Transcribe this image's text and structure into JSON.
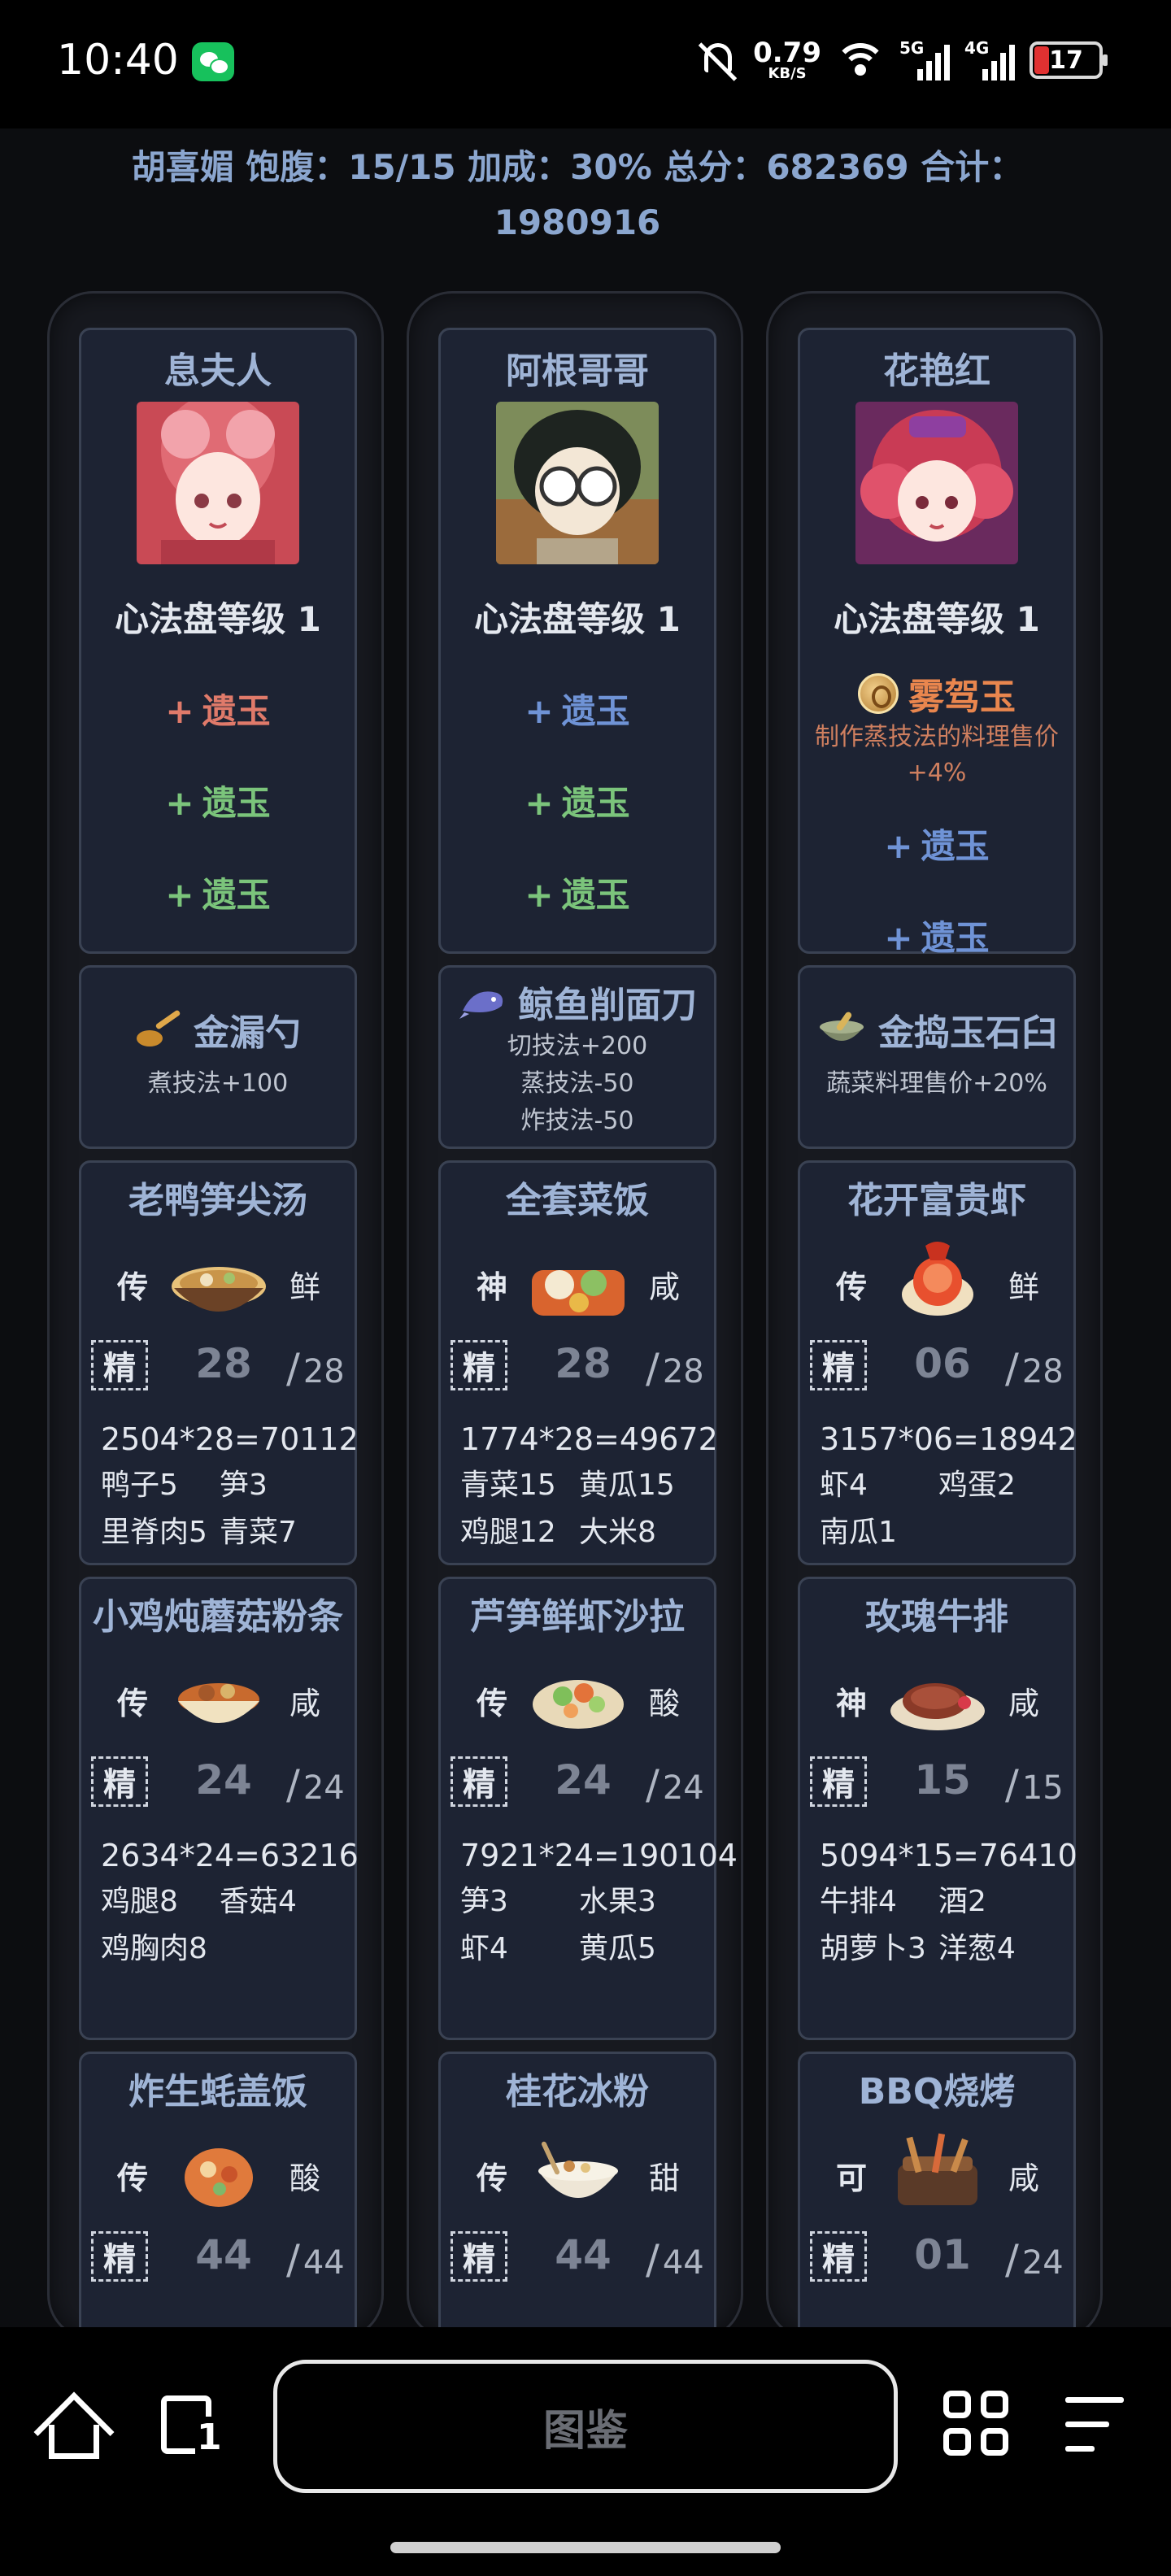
{
  "status_bar": {
    "time": "10:40",
    "net_speed": "0.79",
    "net_unit": "KB/S",
    "signal1": "5G",
    "signal2": "4G",
    "battery": "17",
    "icons": [
      "wechat-icon",
      "mute-icon",
      "wifi-icon",
      "signal-icon",
      "battery-icon"
    ]
  },
  "summary": {
    "line1": "胡喜媚 饱腹：15/15 加成：30% 总分：682369 合计：",
    "line2": "1980916"
  },
  "columns": [
    {
      "chef": {
        "name": "息夫人",
        "level": "心法盘等级 1",
        "relics": [
          {
            "plus": "+",
            "label": "遗玉",
            "color": "#e07a6a"
          },
          {
            "plus": "+",
            "label": "遗玉",
            "color": "#7bc47b"
          },
          {
            "plus": "+",
            "label": "遗玉",
            "color": "#7bc47b"
          }
        ]
      },
      "tool": {
        "name": "金漏勺",
        "desc": [
          "煮技法+100"
        ],
        "icon": "ladle-icon"
      },
      "dishes": [
        {
          "name": "老鸭笋尖汤",
          "rarity": "传",
          "flavor": "鲜",
          "jing": "精",
          "qty": "28",
          "max": "28",
          "calc": "2504*28=70112",
          "ingredients": [
            "鸭子5",
            "笋3",
            "里脊肉5",
            "青菜7"
          ],
          "icon": "soup-bowl-icon"
        },
        {
          "name": "小鸡炖蘑菇粉条",
          "rarity": "传",
          "flavor": "咸",
          "jing": "精",
          "qty": "24",
          "max": "24",
          "calc": "2634*24=63216",
          "ingredients": [
            "鸡腿8",
            "香菇4",
            "鸡胸肉8"
          ],
          "icon": "stew-pot-icon"
        },
        {
          "name": "炸生蚝盖饭",
          "rarity": "传",
          "flavor": "酸",
          "jing": "精",
          "qty": "44",
          "max": "44",
          "icon": "rice-bowl-icon"
        }
      ]
    },
    {
      "chef": {
        "name": "阿根哥哥",
        "level": "心法盘等级 1",
        "relics": [
          {
            "plus": "+",
            "label": "遗玉",
            "color": "#6f93d6"
          },
          {
            "plus": "+",
            "label": "遗玉",
            "color": "#7bc47b"
          },
          {
            "plus": "+",
            "label": "遗玉",
            "color": "#7bc47b"
          }
        ]
      },
      "tool": {
        "name": "鲸鱼削面刀",
        "desc": [
          "切技法+200",
          "蒸技法-50",
          "炸技法-50"
        ],
        "icon": "whale-knife-icon"
      },
      "dishes": [
        {
          "name": "全套菜饭",
          "rarity": "神",
          "flavor": "咸",
          "jing": "精",
          "qty": "28",
          "max": "28",
          "calc": "1774*28=49672",
          "ingredients": [
            "青菜15",
            "黄瓜15",
            "鸡腿12",
            "大米8"
          ],
          "icon": "meal-set-icon"
        },
        {
          "name": "芦笋鲜虾沙拉",
          "rarity": "传",
          "flavor": "酸",
          "jing": "精",
          "qty": "24",
          "max": "24",
          "calc": "7921*24=190104",
          "ingredients": [
            "笋3",
            "水果3",
            "虾4",
            "黄瓜5"
          ],
          "icon": "salad-icon"
        },
        {
          "name": "桂花冰粉",
          "rarity": "传",
          "flavor": "甜",
          "jing": "精",
          "qty": "44",
          "max": "44",
          "icon": "dessert-bowl-icon"
        }
      ]
    },
    {
      "chef": {
        "name": "花艳红",
        "level": "心法盘等级 1",
        "special_relic": {
          "name": "雾驾玉",
          "desc": "制作蒸技法的料理售价+4%"
        },
        "relics": [
          {
            "plus": "+",
            "label": "遗玉",
            "color": "#6f93d6"
          },
          {
            "plus": "+",
            "label": "遗玉",
            "color": "#6f93d6"
          }
        ]
      },
      "tool": {
        "name": "金捣玉石臼",
        "desc": [
          "蔬菜料理售价+20%"
        ],
        "icon": "mortar-icon"
      },
      "dishes": [
        {
          "name": "花开富贵虾",
          "rarity": "传",
          "flavor": "鲜",
          "jing": "精",
          "qty": "06",
          "max": "28",
          "calc": "3157*06=18942",
          "ingredients": [
            "虾4",
            "鸡蛋2",
            "南瓜1"
          ],
          "icon": "shrimp-dish-icon"
        },
        {
          "name": "玫瑰牛排",
          "rarity": "神",
          "flavor": "咸",
          "jing": "精",
          "qty": "15",
          "max": "15",
          "calc": "5094*15=76410",
          "ingredients": [
            "牛排4",
            "酒2",
            "胡萝卜3",
            "洋葱4"
          ],
          "icon": "steak-icon"
        },
        {
          "name": "BBQ烧烤",
          "rarity": "可",
          "flavor": "咸",
          "jing": "精",
          "qty": "01",
          "max": "24",
          "icon": "bbq-icon"
        }
      ]
    }
  ],
  "bottom_nav": {
    "center_label": "图鉴",
    "tabs_count": "1",
    "icons": [
      "home-icon",
      "tabs-icon",
      "apps-icon",
      "menu-icon"
    ]
  }
}
